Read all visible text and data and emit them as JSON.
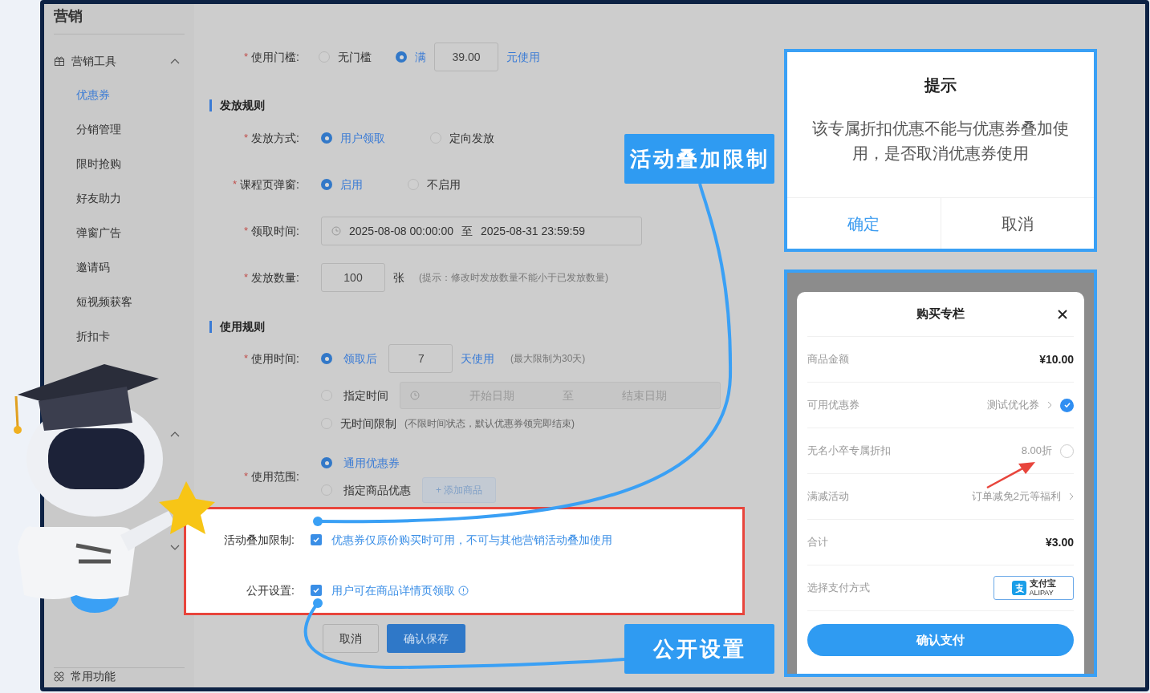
{
  "sidebar": {
    "title": "营销",
    "group": {
      "label": "营销工具",
      "expanded": true
    },
    "items": [
      {
        "label": "优惠券",
        "selected": true
      },
      {
        "label": "分销管理",
        "selected": false
      },
      {
        "label": "限时抢购",
        "selected": false
      },
      {
        "label": "好友助力",
        "selected": false
      },
      {
        "label": "弹窗广告",
        "selected": false
      },
      {
        "label": "邀请码",
        "selected": false
      },
      {
        "label": "短视频获客",
        "selected": false
      },
      {
        "label": "折扣卡",
        "selected": false
      }
    ],
    "footer": "常用功能"
  },
  "form": {
    "threshold": {
      "required": "*",
      "label": "使用门槛:",
      "options": [
        {
          "label": "无门槛",
          "selected": false
        },
        {
          "label": "满",
          "selected": true
        }
      ],
      "value": "39.00",
      "suffix": "元使用"
    },
    "section_issue": "发放规则",
    "issue_method": {
      "required": "*",
      "label": "发放方式:",
      "options": [
        {
          "label": "用户领取",
          "selected": true
        },
        {
          "label": "定向发放",
          "selected": false
        }
      ]
    },
    "popup": {
      "required": "*",
      "label": "课程页弹窗:",
      "options": [
        {
          "label": "启用",
          "selected": true
        },
        {
          "label": "不启用",
          "selected": false
        }
      ]
    },
    "claim_time": {
      "required": "*",
      "label": "领取时间:",
      "start": "2025-08-08 00:00:00",
      "separator": "至",
      "end": "2025-08-31 23:59:59"
    },
    "quantity": {
      "required": "*",
      "label": "发放数量:",
      "value": "100",
      "unit": "张",
      "hint": "(提示：修改时发放数量不能小于已发放数量)"
    },
    "section_use": "使用规则",
    "use_time": {
      "required": "*",
      "label": "使用时间:",
      "options": [
        {
          "kind": "days",
          "label": "领取后",
          "selected": true,
          "value": "7",
          "suffix": "天使用",
          "hint": "(最大限制为30天)"
        },
        {
          "kind": "range",
          "label": "指定时间",
          "selected": false,
          "start_placeholder": "开始日期",
          "separator": "至",
          "end_placeholder": "结束日期"
        },
        {
          "kind": "note",
          "label": "无时间限制",
          "selected": false,
          "hint": "(不限时间状态，默认优惠券领完即结束)"
        }
      ]
    },
    "scope": {
      "required": "*",
      "label": "使用范围:",
      "options": [
        {
          "label": "通用优惠券",
          "selected": true
        },
        {
          "label": "指定商品优惠",
          "selected": false,
          "button": "+ 添加商品"
        }
      ]
    },
    "stacking": {
      "label": "活动叠加限制:",
      "checked": true,
      "text": "优惠券仅原价购买时可用，不可与其他营销活动叠加使用"
    },
    "public": {
      "label": "公开设置:",
      "checked": true,
      "text": "用户可在商品详情页领取"
    },
    "buttons": {
      "cancel": "取消",
      "save": "确认保存"
    }
  },
  "callouts": [
    {
      "text": "活动叠加限制"
    },
    {
      "text": "公开设置"
    }
  ],
  "tip_dialog": {
    "title": "提示",
    "message": "该专属折扣优惠不能与优惠券叠加使用，是否取消优惠券使用",
    "buttons": [
      {
        "label": "确定",
        "kind": "primary"
      },
      {
        "label": "取消",
        "kind": "normal"
      }
    ]
  },
  "payment": {
    "title": "购买专栏",
    "rows": [
      {
        "kind": "amount",
        "label": "商品金额",
        "value": "¥10.00"
      },
      {
        "kind": "check",
        "label": "可用优惠券",
        "value": "测试优化券",
        "chevron": true,
        "checked": true
      },
      {
        "kind": "check",
        "label": "无名小卒专属折扣",
        "value": "8.00折",
        "chevron": false,
        "checked": false
      },
      {
        "kind": "link",
        "label": "满减活动",
        "value": "订单减免2元等福利"
      },
      {
        "kind": "amount",
        "label": "合计",
        "value": "¥3.00"
      },
      {
        "kind": "method",
        "label": "选择支付方式",
        "value": "支付宝",
        "sub": "ALIPAY"
      }
    ],
    "confirm": "确认支付"
  }
}
